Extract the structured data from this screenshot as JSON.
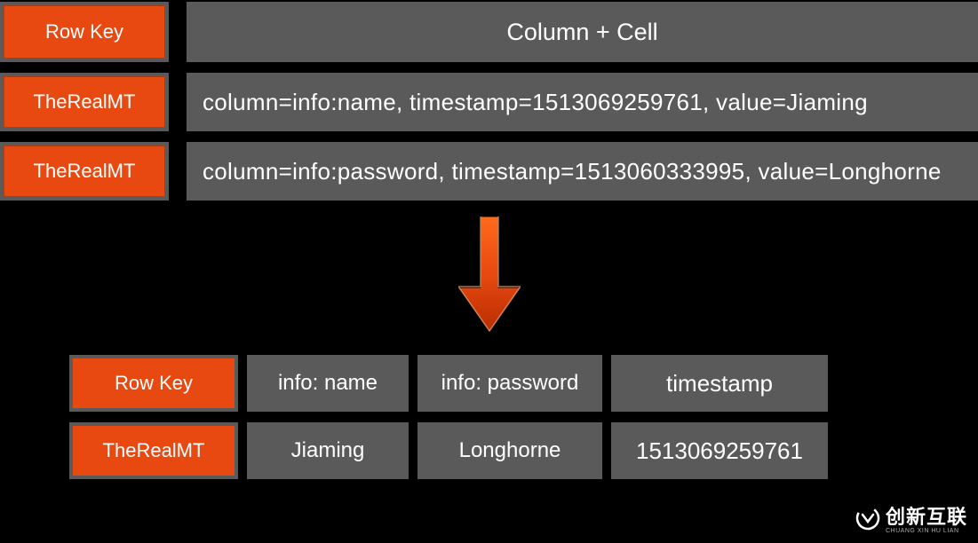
{
  "top": {
    "header_left": "Row Key",
    "header_right": "Column + Cell",
    "rows": [
      {
        "key": "TheRealMT",
        "cell": "column=info:name, timestamp=1513069259761, value=Jiaming"
      },
      {
        "key": "TheRealMT",
        "cell": "column=info:password, timestamp=1513060333995, value=Longhorne"
      }
    ]
  },
  "bottom": {
    "header": [
      "Row Key",
      "info: name",
      "info: password",
      "timestamp"
    ],
    "row": [
      "TheRealMT",
      "Jiaming",
      "Longhorne",
      "1513069259761"
    ]
  },
  "logo": {
    "main": "创新互联",
    "sub": "CHUANG XIN HU LIAN"
  }
}
